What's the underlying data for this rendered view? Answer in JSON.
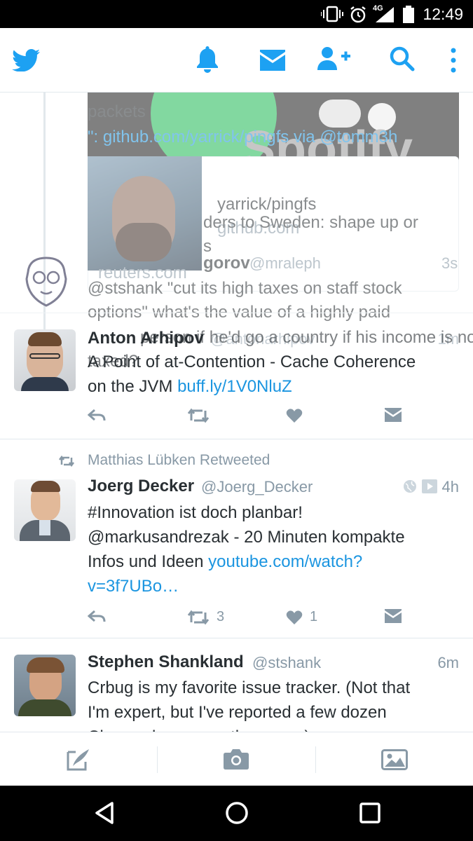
{
  "status_bar": {
    "time": "12:49",
    "network": "4G"
  },
  "header": {
    "icons": [
      "twitter-logo-icon",
      "notifications-bell-icon",
      "messages-envelope-icon",
      "add-user-icon",
      "search-icon",
      "overflow-menu-icon"
    ]
  },
  "ghost_layer": {
    "lines": [
      "packets",
      "\": github.com/yarrick/pingfs via @tomm3h",
      "yarrick/pingfs",
      "github.com",
      "ders to Sweden: shape up or",
      "s",
      "reuters.com",
      "gorov",
      "@mraleph",
      "3s",
      "@stshank \"cut its high taxes on staff stock",
      "options\" what's the value of a highly paid",
      "Anton Arhipov",
      "@antonarhipov",
      "person if he'd go a country if his income is not",
      "taxed?",
      "A Point of at-Contention - Cache Coherence",
      "on the JVM",
      "buff.ly/1V0NluZ",
      "1m",
      "Spotify"
    ]
  },
  "tweets": [
    {
      "retweeted_by": "Matthias Lübken Retweeted",
      "name": "Joerg Decker",
      "handle": "@Joerg_Decker",
      "time": "4h",
      "text_lines": [
        "#Innovation ist doch planbar!",
        "@markusandrezak - 20 Minuten kompakte",
        "Infos und Ideen "
      ],
      "link": "youtube.com/watch?",
      "link2": "v=3f7UBo…",
      "retweets": "3",
      "likes": "1"
    },
    {
      "name": "Stephen Shankland",
      "handle": "@stshank",
      "time": "6m",
      "text_lines": [
        "Crbug is my favorite issue tracker. (Not that",
        "I'm expert, but I've reported a few dozen",
        "Chrome bugs over the years.)"
      ]
    }
  ],
  "tabbar": {
    "icons": [
      "compose-tweet-icon",
      "camera-icon",
      "gallery-icon"
    ]
  },
  "navbar": {
    "icons": [
      "back-icon",
      "home-icon",
      "recents-icon"
    ]
  },
  "colors": {
    "brand": "#1da1f2",
    "link": "#1b95e0",
    "muted": "#8899a6",
    "text": "#292f33"
  }
}
